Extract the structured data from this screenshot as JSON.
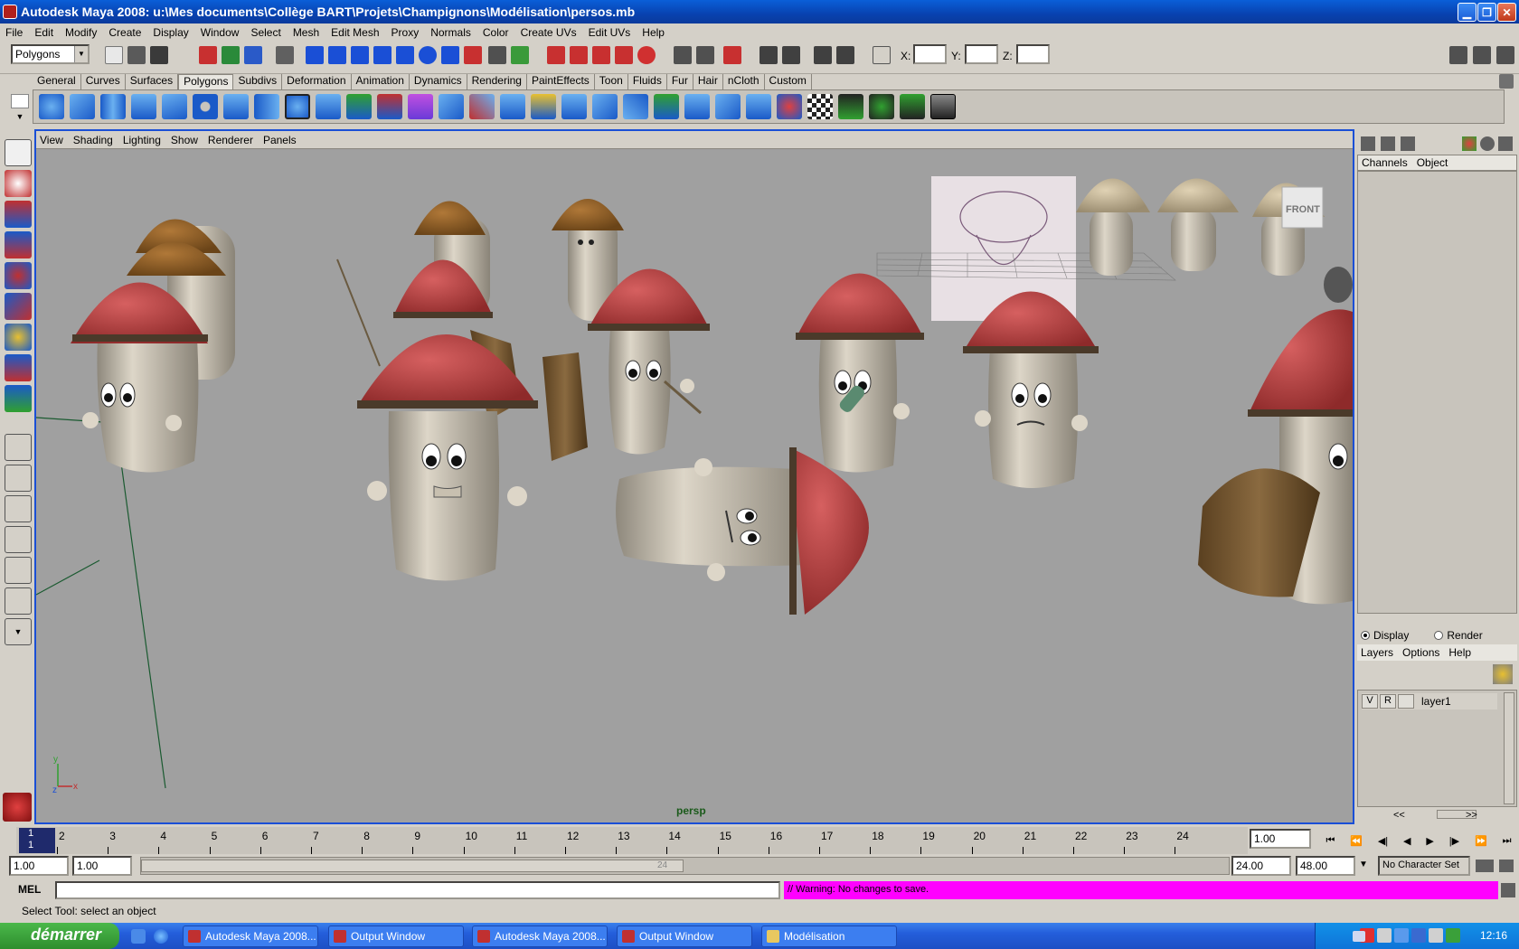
{
  "window": {
    "title": "Autodesk Maya 2008: u:\\Mes documents\\Collège BART\\Projets\\Champignons\\Modélisation\\persos.mb"
  },
  "menu": [
    "File",
    "Edit",
    "Modify",
    "Create",
    "Display",
    "Window",
    "Select",
    "Mesh",
    "Edit Mesh",
    "Proxy",
    "Normals",
    "Color",
    "Create UVs",
    "Edit UVs",
    "Help"
  ],
  "statusline": {
    "mode": "Polygons",
    "x_label": "X:",
    "y_label": "Y:",
    "z_label": "Z:"
  },
  "shelf_tabs": [
    "General",
    "Curves",
    "Surfaces",
    "Polygons",
    "Subdivs",
    "Deformation",
    "Animation",
    "Dynamics",
    "Rendering",
    "PaintEffects",
    "Toon",
    "Fluids",
    "Fur",
    "Hair",
    "nCloth",
    "Custom"
  ],
  "shelf_active": "Polygons",
  "viewport": {
    "menu": [
      "View",
      "Shading",
      "Lighting",
      "Show",
      "Renderer",
      "Panels"
    ],
    "camera": "persp",
    "cube_label": "FRONT"
  },
  "channel_box": {
    "tabs": [
      "Channels",
      "Object"
    ],
    "display_label": "Display",
    "render_label": "Render",
    "layer_menu": [
      "Layers",
      "Options",
      "Help"
    ],
    "layer": {
      "v": "V",
      "r": "R",
      "name": "layer1"
    },
    "scroll_left": "<<",
    "scroll_right": ">>"
  },
  "timeline": {
    "current_frame": "1",
    "frames": [
      "2",
      "3",
      "4",
      "5",
      "6",
      "7",
      "8",
      "9",
      "10",
      "11",
      "12",
      "13",
      "14",
      "15",
      "16",
      "17",
      "18",
      "19",
      "20",
      "21",
      "22",
      "23",
      "24"
    ],
    "current_time": "1.00"
  },
  "range": {
    "start": "1.00",
    "playback_start": "1.00",
    "playback_end": "24.00",
    "end": "48.00",
    "slider_label": "24",
    "character_set": "No Character Set"
  },
  "command": {
    "label": "MEL",
    "result": "// Warning: No changes to save."
  },
  "help_line": "Select Tool: select an object",
  "taskbar": {
    "start": "démarrer",
    "items": [
      "Autodesk Maya 2008...",
      "Output Window",
      "Autodesk Maya 2008...",
      "Output Window",
      "Modélisation"
    ],
    "clock": "12:16"
  },
  "colors": {
    "title_blue": "#0a5fd8",
    "viewport_bg": "#a0a0a0",
    "warning_magenta": "#ff00ff",
    "cap_red": "#c94a4a",
    "cap_brown": "#9a6630"
  }
}
